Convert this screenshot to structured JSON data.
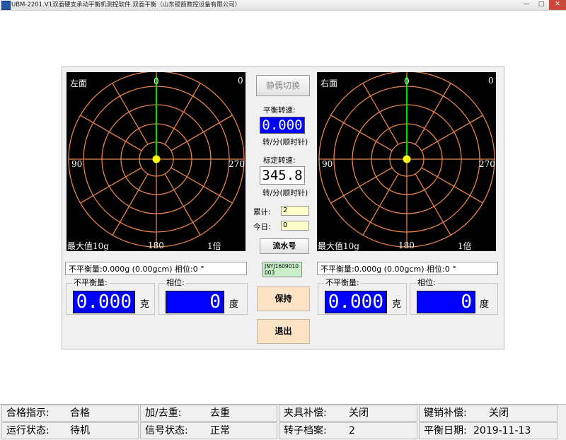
{
  "window": {
    "title": "UBM-2201.V1双面硬支承动平衡机测控软件.双面平衡（山东银箭数控设备有限公司）",
    "min_label": "—",
    "max_label": "□",
    "close_label": "✕"
  },
  "left_plane": {
    "name": "左面",
    "corner_value": "0",
    "angle_top": "0",
    "angle_left": "90",
    "angle_right": "270",
    "angle_bottom": "180",
    "max_label": "最大值10g",
    "scale": "1倍",
    "summary": "不平衡量:0.000g (0.00gcm) 相位:0 °",
    "unbalance_title": "不平衡量:",
    "unbalance_value": "0.000",
    "unbalance_unit": "克",
    "phase_title": "相位:",
    "phase_value": "0",
    "phase_unit": "度"
  },
  "right_plane": {
    "name": "右面",
    "corner_value": "0",
    "angle_top": "0",
    "angle_left": "90",
    "angle_right": "270",
    "angle_bottom": "180",
    "max_label": "最大值10g",
    "scale": "1倍",
    "summary": "不平衡量:0.000g (0.00gcm) 相位:0 °",
    "unbalance_title": "不平衡量:",
    "unbalance_value": "0.000",
    "unbalance_unit": "克",
    "phase_title": "相位:",
    "phase_value": "0",
    "phase_unit": "度"
  },
  "center": {
    "switch_button": "静偶切换",
    "balance_speed_label": "平衡转速:",
    "balance_speed_value": "0.000",
    "balance_speed_unit": "转/分(顺时针)",
    "calib_speed_label": "标定转速:",
    "calib_speed_value": "345.8",
    "calib_speed_unit": "转/分(顺时针)",
    "total_label": "累计:",
    "total_value": "2",
    "today_label": "今日:",
    "today_value": "0",
    "serial_button": "流水号",
    "serial_value": "JNYJ1609010003",
    "hold_button": "保持",
    "exit_button": "退出"
  },
  "status_bar": {
    "row1": [
      {
        "key": "合格指示:",
        "value": "合格"
      },
      {
        "key": "加/去重:",
        "value": "去重"
      },
      {
        "key": "夹具补偿:",
        "value": "关闭"
      },
      {
        "key": "键销补偿:",
        "value": "关闭"
      }
    ],
    "row2": [
      {
        "key": "运行状态:",
        "value": "待机"
      },
      {
        "key": "信号状态:",
        "value": "正常"
      },
      {
        "key": "转子档案:",
        "value": "2"
      },
      {
        "key": "平衡日期:",
        "value": "2019-11-13"
      }
    ]
  },
  "colors": {
    "grid": "#e8834a",
    "needle": "#00dd00",
    "center_dot": "#ffff00",
    "digit_background": "#0000ff",
    "button_peach": "#fce3c6"
  }
}
